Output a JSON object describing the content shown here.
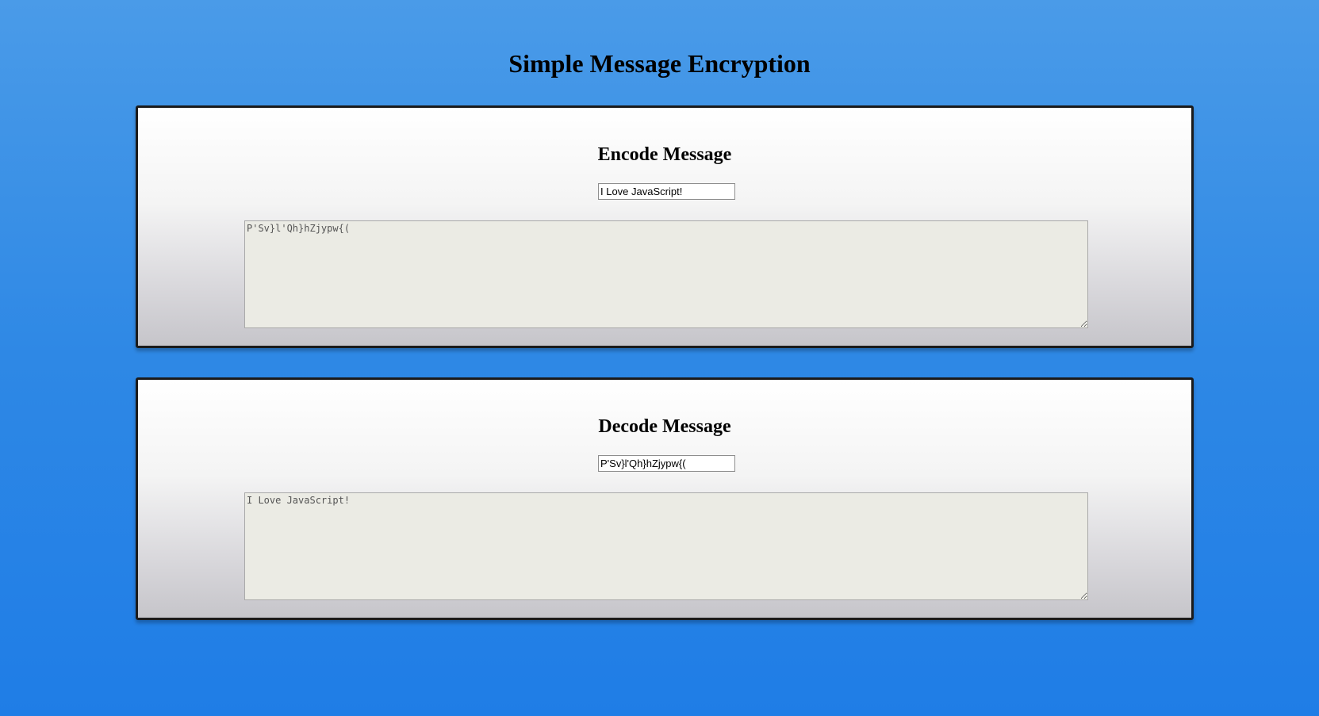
{
  "page": {
    "title": "Simple Message Encryption"
  },
  "encode": {
    "title": "Encode Message",
    "input_value": "I Love JavaScript!",
    "output_value": "P'Sv}l'Qh}hZjypw{("
  },
  "decode": {
    "title": "Decode Message",
    "input_value": "P'Sv}l'Qh}hZjypw{(",
    "output_value": "I Love JavaScript!"
  },
  "colors": {
    "background_top": "#4a9be8",
    "background_bottom": "#1f7de6",
    "panel_border": "#1b1b1b",
    "output_background": "#ebebe4"
  }
}
